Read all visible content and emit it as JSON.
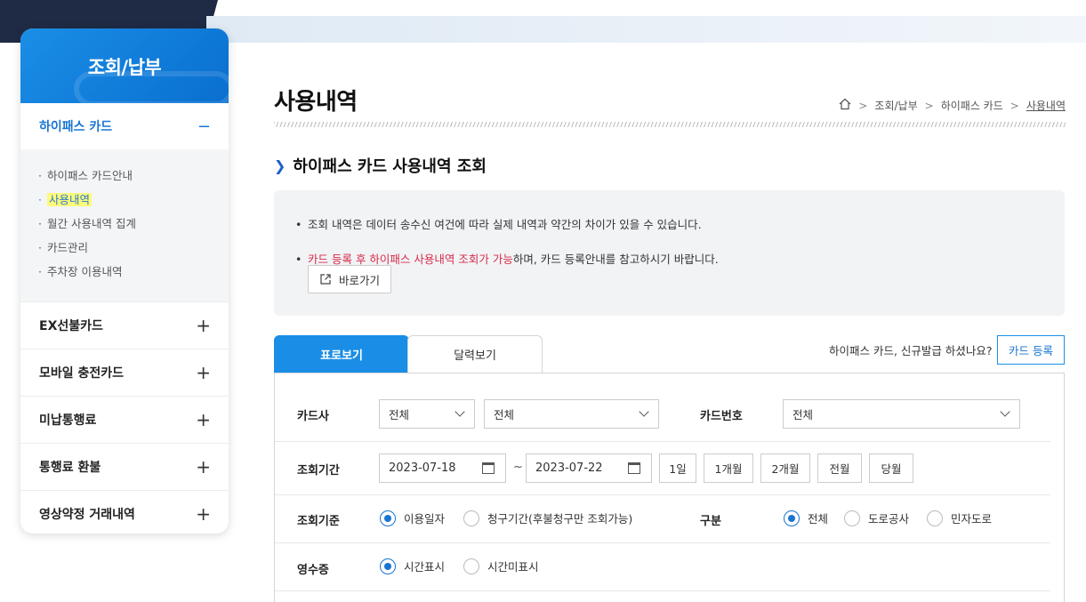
{
  "sidebar": {
    "title": "조회/납부",
    "open_menu": {
      "label": "하이패스 카드",
      "toggle": "−"
    },
    "submenu": [
      {
        "label": "하이패스 카드안내"
      },
      {
        "label": "사용내역"
      },
      {
        "label": "월간 사용내역 집계"
      },
      {
        "label": "카드관리"
      },
      {
        "label": "주차장 이용내역"
      }
    ],
    "menus": [
      {
        "label": "EX선불카드",
        "toggle": "+"
      },
      {
        "label": "모바일 충전카드",
        "toggle": "+"
      },
      {
        "label": "미납통행료",
        "toggle": "+"
      },
      {
        "label": "통행료 환불",
        "toggle": "+"
      },
      {
        "label": "영상약정 거래내역",
        "toggle": "+"
      }
    ]
  },
  "page": {
    "title": "사용내역",
    "breadcrumb": [
      "조회/납부",
      "하이패스 카드",
      "사용내역"
    ]
  },
  "section": {
    "title": "하이패스 카드 사용내역 조회"
  },
  "notice": {
    "line1": "조회 내역은 데이터 송수신 여건에 따라 실제 내역과 약간의 차이가 있을 수 있습니다.",
    "line2_red": "카드 등록 후 하이패스 사용내역 조회가 가능",
    "line2_rest": "하며, 카드 등록안내를 참고하시기 바랍니다.",
    "goto_label": "바로가기"
  },
  "tabs": {
    "table_view": "표로보기",
    "calendar_view": "달력보기"
  },
  "issue_question": "하이패스 카드, 신규발급 하셨나요?",
  "register_button": "카드 등록",
  "form": {
    "card_company": {
      "label": "카드사",
      "select1": "전체",
      "select2": "전체"
    },
    "card_number": {
      "label": "카드번호",
      "value": "전체"
    },
    "period": {
      "label": "조회기간",
      "start": "2023-07-18",
      "tilde": "~",
      "end": "2023-07-22",
      "buttons": [
        "1일",
        "1개월",
        "2개월",
        "전월",
        "당월"
      ]
    },
    "basis": {
      "label": "조회기준",
      "options": [
        "이용일자",
        "청구기간(후불청구만 조회가능)"
      ],
      "selected": "이용일자"
    },
    "division": {
      "label": "구분",
      "options": [
        "전체",
        "도로공사",
        "민자도로"
      ],
      "selected": "전체"
    },
    "receipt": {
      "label": "영수증",
      "options": [
        "시간표시",
        "시간미표시"
      ],
      "selected": "시간표시"
    }
  },
  "colors": {
    "accent": "#1a8ee6",
    "highlight": "#fffb7a",
    "notice_red": "#d62b4a"
  }
}
